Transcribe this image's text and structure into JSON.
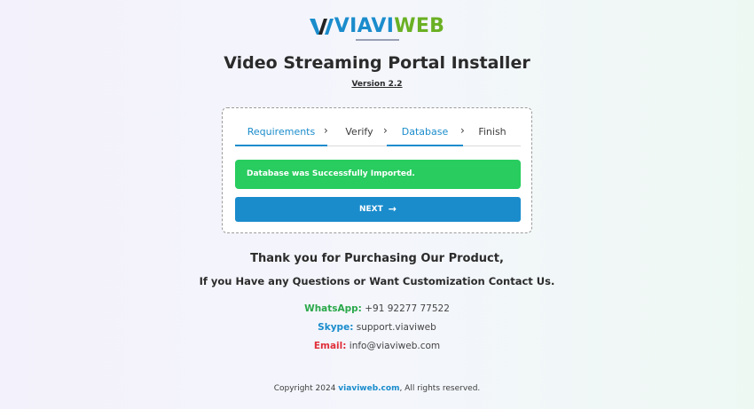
{
  "logo": {
    "part_via": "VIAVI",
    "part_web": "WEB",
    "colors": {
      "via": "#1a8ccc",
      "web": "#6ab023"
    }
  },
  "title": "Video Streaming Portal Installer",
  "version": "Version 2.2",
  "steps": [
    {
      "label": "Requirements",
      "active": true
    },
    {
      "label": "Verify",
      "active": false
    },
    {
      "label": "Database",
      "active": true
    },
    {
      "label": "Finish",
      "active": false
    }
  ],
  "alert": {
    "text": "Database was Successfully Imported.",
    "color": "#28cc5f"
  },
  "next_button": {
    "label": "NEXT",
    "icon": "arrow-right-icon",
    "color": "#1a8ccc"
  },
  "thanks": "Thank you for Purchasing Our Product,",
  "contact_prompt": "If you Have any Questions or Want Customization Contact Us.",
  "contacts": {
    "whatsapp": {
      "label": "WhatsApp:",
      "value": "+91 92277 77522",
      "color": "#2aa84a"
    },
    "skype": {
      "label": "Skype:",
      "value": "support.viaviweb",
      "color": "#1a8ccc"
    },
    "email": {
      "label": "Email:",
      "value": "info@viaviweb.com",
      "color": "#e0303a"
    }
  },
  "footer": {
    "prefix": "Copyright 2024 ",
    "link": "viaviweb.com",
    "suffix": ", All rights reserved."
  }
}
